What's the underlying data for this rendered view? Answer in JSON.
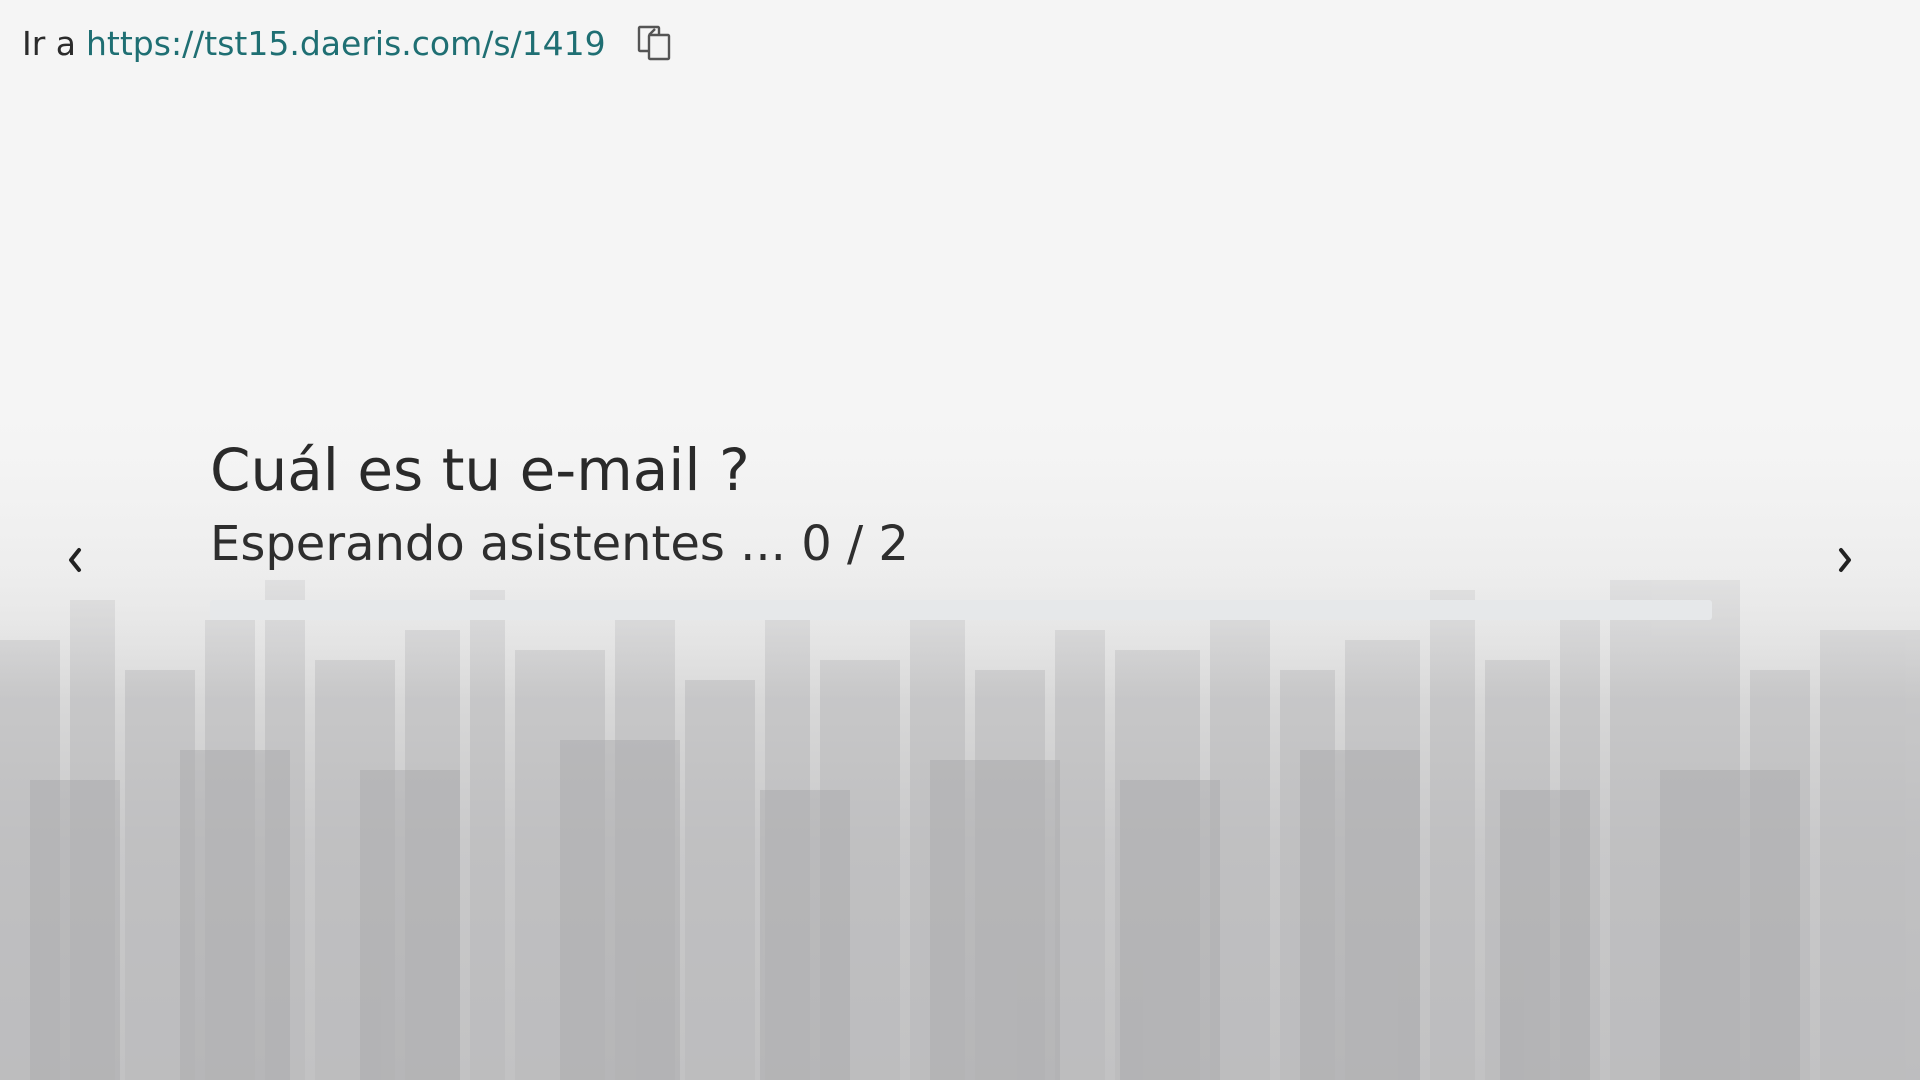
{
  "link": {
    "prefix": "Ir a",
    "url": "https://tst15.daeris.com/s/1419",
    "copy_icon": "copy-icon"
  },
  "question": {
    "title": "Cuál es tu e-mail ?"
  },
  "status": {
    "text": "Esperando asistentes ... 0 / 2",
    "current": 0,
    "total": 2,
    "progress_fraction": 0
  },
  "navigation": {
    "prev_icon": "chevron-left-icon",
    "next_icon": "chevron-right-icon"
  },
  "colors": {
    "link": "#1f6f73",
    "text": "#2b2b2b",
    "progress_track": "#e6e8ea"
  }
}
